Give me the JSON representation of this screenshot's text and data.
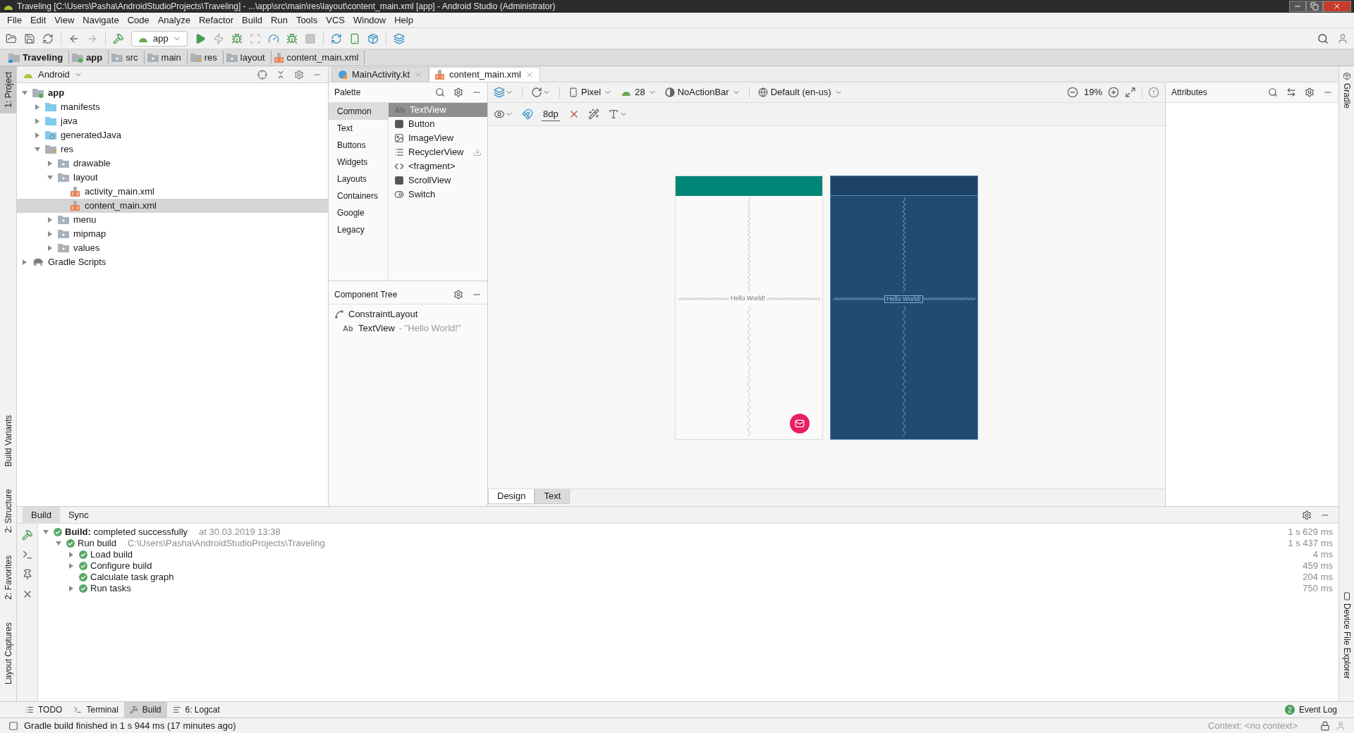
{
  "window": {
    "title": "Traveling [C:\\Users\\Pasha\\AndroidStudioProjects\\Traveling] - ...\\app\\src\\main\\res\\layout\\content_main.xml [app] - Android Studio (Administrator)"
  },
  "menu": [
    "File",
    "Edit",
    "View",
    "Navigate",
    "Code",
    "Analyze",
    "Refactor",
    "Build",
    "Run",
    "Tools",
    "VCS",
    "Window",
    "Help"
  ],
  "toolbar": {
    "run_config": "app"
  },
  "breadcrumbs": [
    {
      "label": "Traveling",
      "kind": "project"
    },
    {
      "label": "app",
      "kind": "module"
    },
    {
      "label": "src",
      "kind": "folder"
    },
    {
      "label": "main",
      "kind": "folder"
    },
    {
      "label": "res",
      "kind": "res"
    },
    {
      "label": "layout",
      "kind": "folder"
    },
    {
      "label": "content_main.xml",
      "kind": "xml"
    }
  ],
  "left_strip": [
    {
      "label": "1: Project",
      "selected": true
    },
    {
      "label": "Build Variants",
      "selected": false
    },
    {
      "label": "2: Structure",
      "selected": false
    },
    {
      "label": "2: Favorites",
      "selected": false
    },
    {
      "label": "Layout Captures",
      "selected": false
    }
  ],
  "right_strip": [
    {
      "label": "Gradle"
    },
    {
      "label": "Device File Explorer"
    }
  ],
  "project_panel": {
    "view": "Android",
    "tree": [
      {
        "label": "app",
        "kind": "module",
        "expanded": true,
        "selected": false,
        "children": [
          {
            "label": "manifests",
            "kind": "source",
            "expanded": false,
            "selected": false
          },
          {
            "label": "java",
            "kind": "source",
            "expanded": false,
            "selected": false
          },
          {
            "label": "generatedJava",
            "kind": "generated",
            "expanded": false,
            "selected": false
          },
          {
            "label": "res",
            "kind": "res",
            "expanded": true,
            "selected": false,
            "children": [
              {
                "label": "drawable",
                "kind": "folder",
                "expanded": false,
                "selected": false
              },
              {
                "label": "layout",
                "kind": "folder",
                "expanded": true,
                "selected": false,
                "children": [
                  {
                    "label": "activity_main.xml",
                    "kind": "xml",
                    "selected": false
                  },
                  {
                    "label": "content_main.xml",
                    "kind": "xml",
                    "selected": true
                  }
                ]
              },
              {
                "label": "menu",
                "kind": "folder",
                "expanded": false,
                "selected": false
              },
              {
                "label": "mipmap",
                "kind": "folder",
                "expanded": false,
                "selected": false
              },
              {
                "label": "values",
                "kind": "folder",
                "expanded": false,
                "selected": false
              }
            ]
          }
        ]
      },
      {
        "label": "Gradle Scripts",
        "kind": "gradle",
        "expanded": false,
        "selected": false
      }
    ]
  },
  "editor_tabs": [
    {
      "label": "MainActivity.kt",
      "kind": "kotlin",
      "selected": false
    },
    {
      "label": "content_main.xml",
      "kind": "xml",
      "selected": true
    }
  ],
  "palette": {
    "title": "Palette",
    "categories": [
      {
        "label": "Common",
        "selected": true
      },
      {
        "label": "Text",
        "selected": false
      },
      {
        "label": "Buttons",
        "selected": false
      },
      {
        "label": "Widgets",
        "selected": false
      },
      {
        "label": "Layouts",
        "selected": false
      },
      {
        "label": "Containers",
        "selected": false
      },
      {
        "label": "Google",
        "selected": false
      },
      {
        "label": "Legacy",
        "selected": false
      }
    ],
    "items": [
      {
        "label": "TextView",
        "kind": "text",
        "icon": "Ab",
        "selected": true,
        "download": false
      },
      {
        "label": "Button",
        "kind": "button",
        "selected": false,
        "download": false
      },
      {
        "label": "ImageView",
        "kind": "image",
        "selected": false,
        "download": false
      },
      {
        "label": "RecyclerView",
        "kind": "list",
        "selected": false,
        "download": true
      },
      {
        "label": "<fragment>",
        "kind": "fragment",
        "selected": false,
        "download": false
      },
      {
        "label": "ScrollView",
        "kind": "scroll",
        "selected": false,
        "download": false
      },
      {
        "label": "Switch",
        "kind": "switch",
        "selected": false,
        "download": false
      }
    ]
  },
  "component_tree": {
    "title": "Component Tree",
    "items": [
      {
        "label": "ConstraintLayout",
        "kind": "constraint",
        "children": [
          {
            "label": "TextView",
            "kind": "text",
            "icon": "Ab",
            "detail": "- \"Hello World!\""
          }
        ]
      }
    ]
  },
  "design_toolbar": {
    "device": "Pixel",
    "api": "28",
    "theme": "NoActionBar",
    "locale": "Default (en-us)",
    "zoom": "19%",
    "margin": "8dp"
  },
  "attributes": {
    "title": "Attributes"
  },
  "design_preview": {
    "text": "Hello World!"
  },
  "blueprint_preview": {
    "text": "Hello World!"
  },
  "editor_mode_tabs": [
    {
      "label": "Design",
      "selected": true
    },
    {
      "label": "Text",
      "selected": false
    }
  ],
  "build_panel": {
    "tabs": [
      {
        "label": "Build",
        "selected": true
      },
      {
        "label": "Sync",
        "selected": false
      }
    ],
    "rows": [
      {
        "label": "**Build:** completed successfully",
        "detail": "at 30.03.2019 13:38",
        "time": "1 s 629 ms",
        "expanded": true,
        "children": [
          {
            "label": "Run build",
            "detail": "C:\\Users\\Pasha\\AndroidStudioProjects\\Traveling",
            "time": "1 s 437 ms",
            "expanded": true,
            "children": [
              {
                "label": "Load build",
                "time": "4 ms",
                "expanded": false
              },
              {
                "label": "Configure build",
                "time": "459 ms",
                "expanded": false
              },
              {
                "label": "Calculate task graph",
                "time": "204 ms"
              },
              {
                "label": "Run tasks",
                "time": "750 ms",
                "expanded": false
              }
            ]
          }
        ]
      }
    ]
  },
  "bottom_tabs": [
    {
      "label": "TODO",
      "kind": "todo",
      "selected": false
    },
    {
      "label": "Terminal",
      "kind": "terminal",
      "selected": false
    },
    {
      "label": "Build",
      "kind": "build",
      "selected": true
    },
    {
      "label": "6: Logcat",
      "kind": "logcat",
      "selected": false
    }
  ],
  "event_log": {
    "label": "Event Log",
    "count": "2"
  },
  "status_bar": {
    "message": "Gradle build finished in 1 s 944 ms (17 minutes ago)",
    "context": "Context: <no context>"
  }
}
